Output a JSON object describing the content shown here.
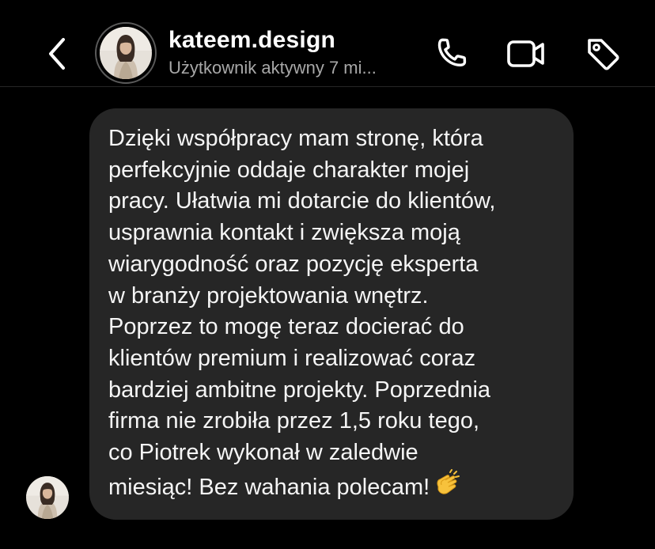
{
  "header": {
    "back_icon": "chevron-left-icon",
    "name": "kateem.design",
    "status": "Użytkownik aktywny 7 mi...",
    "actions": {
      "call_icon": "phone-icon",
      "video_icon": "video-camera-icon",
      "tag_icon": "tag-icon"
    }
  },
  "message": {
    "lines": [
      "Dzięki współpracy mam stronę, która",
      "perfekcyjnie oddaje charakter mojej",
      "pracy. Ułatwia mi dotarcie do klientów,",
      "usprawnia kontakt i zwiększa moją",
      "wiarygodność oraz pozycję eksperta",
      "w branży projektowania wnętrz.",
      "Poprzez to mogę teraz docierać do",
      "klientów premium i realizować coraz",
      "bardziej ambitne projekty. Poprzednia",
      "firma nie zrobiła przez 1,5 roku tego,",
      "co Piotrek wykonał w zaledwie",
      "miesiąc! Bez wahania polecam!"
    ],
    "emoji": "clapping-hands-emoji"
  },
  "colors": {
    "background": "#000000",
    "bubble": "#262626",
    "text": "#ffffff",
    "secondary_text": "#a8a8a8"
  }
}
